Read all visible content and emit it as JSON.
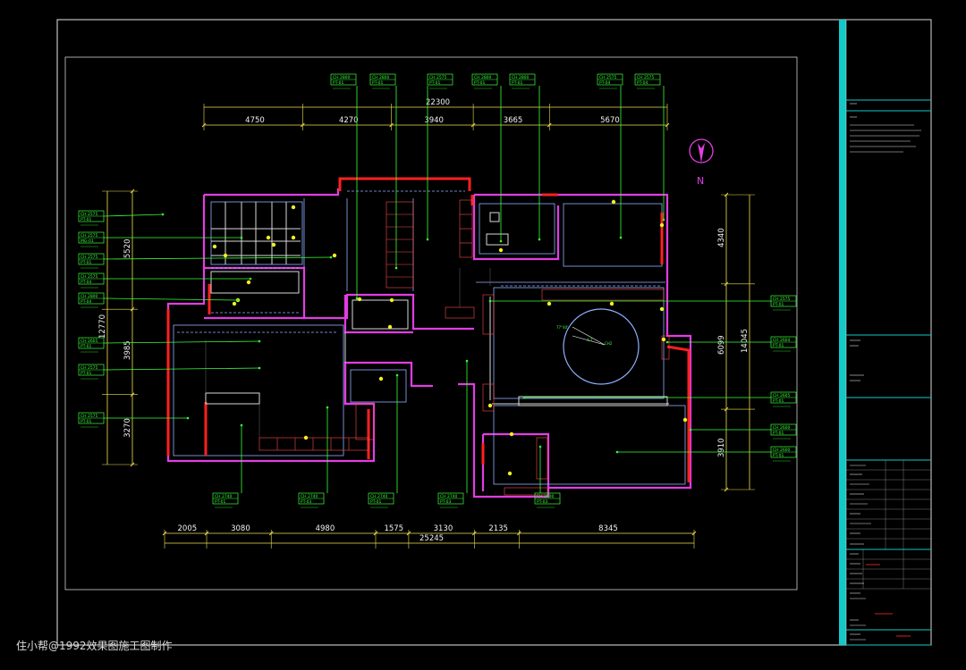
{
  "drawing": {
    "north_label": "N",
    "dims_top": {
      "total": "22300",
      "segments": [
        "4750",
        "4270",
        "3940",
        "3665",
        "5670"
      ]
    },
    "dims_bottom": {
      "total": "25245",
      "segments": [
        "2005",
        "3080",
        "4980",
        "1575",
        "3130",
        "2135",
        "8345"
      ]
    },
    "dims_left": {
      "total": "12770",
      "segments": [
        "5520",
        "3985",
        "3270"
      ]
    },
    "dims_right": {
      "total": "14045",
      "segments": [
        "4340",
        "6099",
        "3910"
      ]
    },
    "ceiling_tags": {
      "top": [
        {
          "h": "CH 2800",
          "m": "PT-01"
        },
        {
          "h": "CH 2800",
          "m": "PT-01"
        },
        {
          "h": "CH 2575",
          "m": "PT-01"
        },
        {
          "h": "CH 2800",
          "m": "PT-01"
        },
        {
          "h": "CH 2800",
          "m": "PT-01"
        },
        {
          "h": "CH 2575",
          "m": "PT-04"
        },
        {
          "h": "CH 2575",
          "m": "PT-04"
        }
      ],
      "left": [
        {
          "h": "CH 2575",
          "m": "PT-01"
        },
        {
          "h": "CH 2575",
          "m": "MG-01"
        },
        {
          "h": "CH 2575",
          "m": "PT-01"
        },
        {
          "h": "CH 2575",
          "m": "PT-04"
        },
        {
          "h": "CH 2800",
          "m": "PT-04"
        },
        {
          "h": "CH 2605",
          "m": "PT-01"
        },
        {
          "h": "CH 2575",
          "m": "PT-01"
        },
        {
          "h": "CH 2575",
          "m": "PT-01"
        }
      ],
      "right": [
        {
          "h": "CH 2575",
          "m": "PT-01"
        },
        {
          "h": "CH 2604",
          "m": "PT-01"
        },
        {
          "h": "CH 2605",
          "m": "PT-01"
        },
        {
          "h": "CH 2600",
          "m": "PT-01"
        },
        {
          "h": "CH 2600",
          "m": "PT-01"
        }
      ],
      "bottom": [
        {
          "h": "CH 2740",
          "m": "PT-01"
        },
        {
          "h": "CH 2740",
          "m": "PT-03"
        },
        {
          "h": "CH 2740",
          "m": "PT-01"
        },
        {
          "h": "CH 2740",
          "m": "PT-03"
        },
        {
          "h": "CH 2600",
          "m": "PT-03"
        }
      ]
    }
  },
  "watermark": "住小帮@1992效果图施工图制作"
}
